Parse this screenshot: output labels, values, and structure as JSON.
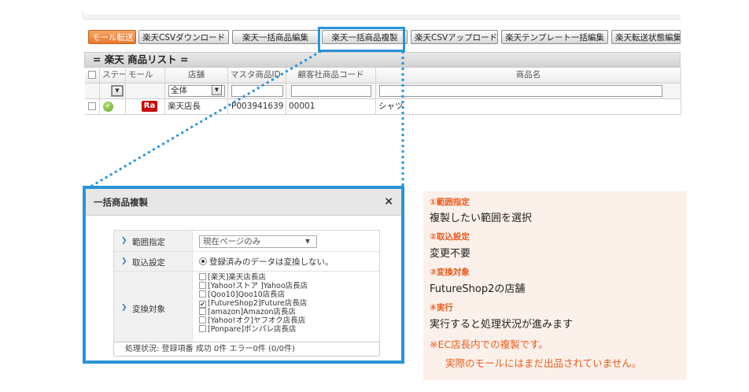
{
  "toolbar": {
    "buttons": [
      {
        "label": "モール転送",
        "style": "orange"
      },
      {
        "label": "楽天CSVダウンロード",
        "style": "normal"
      },
      {
        "label": "楽天一括商品編集",
        "style": "normal"
      },
      {
        "label": "楽天一括商品複製",
        "style": "normal"
      },
      {
        "label": "楽天CSVアップロード",
        "style": "normal"
      },
      {
        "label": "楽天テンプレート一括編集",
        "style": "normal"
      },
      {
        "label": "楽天転送状態編集",
        "style": "normal"
      }
    ]
  },
  "list": {
    "title": "= 楽天 商品リスト =",
    "columns": [
      "ステー",
      "モール",
      "店舗",
      "マスタ商品ID",
      "顧客社商品コード",
      "商品名"
    ],
    "filter": {
      "store_value": "全体"
    },
    "rows": [
      {
        "mall_badge": "Ra",
        "store": "楽天店長",
        "master_id": "P003941639",
        "code": "00001",
        "name": "シャツ"
      }
    ]
  },
  "dialog": {
    "title": "一括商品複製",
    "close_glyph": "×",
    "fields": {
      "range_label": "範囲指定",
      "range_value": "現在ページのみ",
      "import_label": "取込設定",
      "import_value": "登録済みのデータは変換しない。",
      "target_label": "変換対象",
      "targets": [
        {
          "label": "[楽天]楽天店長店",
          "checked": false
        },
        {
          "label": "[Yahoo!ストア ]Yahoo店長店",
          "checked": false
        },
        {
          "label": "[Qoo10]Qoo10店長店",
          "checked": false
        },
        {
          "label": "[FutureShop2]Future店長店",
          "checked": true
        },
        {
          "label": "[amazon]Amazon店長店",
          "checked": false
        },
        {
          "label": "[Yahoo!オク]ヤフオク店長店",
          "checked": false
        },
        {
          "label": "[Ponpare]ポンパレ店長店",
          "checked": false
        }
      ]
    },
    "status": "処理状況: 登録項番 成功 0件 エラー0件 (0/0件)"
  },
  "note": {
    "h1": "①範囲指定",
    "t1": "複製したい範囲を選択",
    "h2": "②取込設定",
    "t2": "変更不要",
    "h3": "③変換対象",
    "t3": "FutureShop2の店舗",
    "h4": "④実行",
    "t4": "実行すると処理状況が進みます",
    "w1": "※EC店長内での複製です。",
    "w2": "実際のモールにはまだ出品されていません。"
  },
  "colors": {
    "accent": "#2b93d6",
    "note_heading": "#e85a1f",
    "note_bg": "#fbf1ea",
    "rakuten": "#c40d0d"
  }
}
